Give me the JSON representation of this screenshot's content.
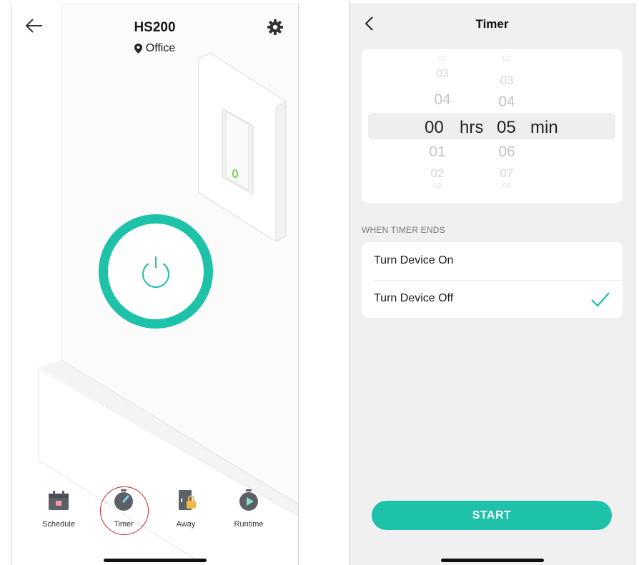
{
  "left_screen": {
    "title": "HS200",
    "location": "Office",
    "power_state": "on",
    "toolbar": [
      {
        "label": "Schedule",
        "icon": "calendar-icon"
      },
      {
        "label": "Timer",
        "icon": "stopwatch-icon"
      },
      {
        "label": "Away",
        "icon": "away-icon"
      },
      {
        "label": "Runtime",
        "icon": "runtime-icon"
      }
    ]
  },
  "right_screen": {
    "title": "Timer",
    "picker": {
      "hours": {
        "above": [
          "02",
          "03",
          "04"
        ],
        "selected": "00",
        "below": [
          "01",
          "02",
          "03"
        ],
        "unit": "hrs"
      },
      "minutes": {
        "above": [
          "02",
          "03",
          "04"
        ],
        "selected": "05",
        "below": [
          "06",
          "07",
          "08"
        ],
        "unit": "min"
      }
    },
    "section_label": "WHEN TIMER ENDS",
    "options": [
      {
        "label": "Turn Device On",
        "selected": false
      },
      {
        "label": "Turn Device Off",
        "selected": true
      }
    ],
    "start_label": "START"
  },
  "colors": {
    "accent": "#1ec2a8",
    "highlight_ring": "#c8262a",
    "screen_bg": "#f0f0f1"
  }
}
